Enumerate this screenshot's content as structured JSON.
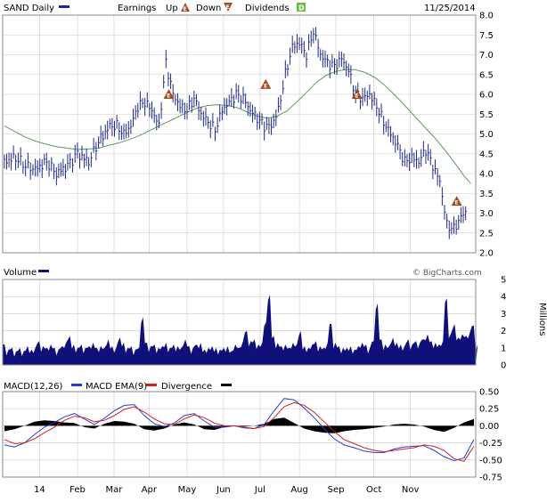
{
  "header": {
    "symbol_label": "SAND Daily",
    "earnings_label": "Earnings",
    "up_label": "Up",
    "down_label": "Down",
    "dividends_label": "Dividends",
    "date": "11/25/2014",
    "earnings_up_icon": "triangle-e-icon",
    "earnings_down_icon": "inverted-triangle-e-icon",
    "dividend_icon": "green-square-d-icon",
    "e_glyph": "E",
    "d_glyph": "D"
  },
  "colors": {
    "price": "#1f2a8a",
    "ma": "#5a9a5a",
    "volume": "#10107a",
    "macd": "#1f3fd0",
    "macd_ema": "#d02020",
    "divergence": "#000000",
    "earnings": "#a34a1f",
    "dividend": "#6bbf3a",
    "grid": "#c8c8c8",
    "frame": "#888888"
  },
  "watermark": "© BigCharts.com",
  "chart_data": [
    {
      "type": "ohlc",
      "name": "price",
      "symbol": "SAND",
      "ylim": [
        2.0,
        8.0
      ],
      "y_ticks": [
        "8.0",
        "7.5",
        "7.0",
        "6.5",
        "6.0",
        "5.5",
        "5.0",
        "4.5",
        "4.0",
        "3.5",
        "3.0",
        "2.5",
        "2.0"
      ],
      "x_ticks": [
        "14",
        "Feb",
        "Mar",
        "Apr",
        "May",
        "Jun",
        "Jul",
        "Aug",
        "Sep",
        "Oct",
        "Nov"
      ],
      "x": [
        0,
        8,
        15,
        22,
        30,
        37,
        45,
        52,
        60,
        67,
        75,
        80,
        85,
        90,
        95,
        100,
        105,
        110,
        115,
        120,
        125,
        130,
        135,
        140,
        145,
        150,
        155,
        160,
        165,
        170,
        175,
        180,
        185,
        190,
        195,
        200,
        205,
        210,
        215,
        220,
        225,
        230,
        235,
        240,
        245,
        250,
        255,
        260,
        265,
        270,
        275,
        280,
        285,
        290,
        295,
        300,
        305,
        310,
        315,
        320,
        325,
        330
      ],
      "close": [
        4.3,
        4.4,
        4.2,
        4.1,
        4.3,
        4.0,
        4.2,
        4.5,
        4.3,
        4.8,
        5.2,
        5.2,
        5.0,
        5.2,
        5.7,
        5.8,
        5.6,
        5.2,
        6.8,
        6.0,
        5.7,
        5.6,
        5.9,
        5.5,
        5.3,
        5.1,
        5.6,
        5.8,
        6.0,
        5.9,
        5.6,
        5.4,
        5.2,
        5.2,
        5.6,
        6.5,
        7.2,
        7.3,
        7.0,
        7.6,
        7.0,
        6.8,
        6.7,
        6.9,
        6.6,
        6.0,
        5.9,
        6.0,
        5.7,
        5.3,
        5.0,
        4.7,
        4.3,
        4.4,
        4.3,
        4.6,
        4.2,
        3.8,
        2.7,
        2.6,
        2.9,
        3.1
      ],
      "ma": [
        5.2,
        5.05,
        4.92,
        4.82,
        4.74,
        4.68,
        4.64,
        4.61,
        4.62,
        4.64,
        4.72,
        4.78,
        4.86,
        4.96,
        5.08,
        5.2,
        5.32,
        5.44,
        5.56,
        5.66,
        5.72,
        5.74,
        5.72,
        5.66,
        5.55,
        5.45,
        5.4,
        5.45,
        5.58,
        5.8,
        6.05,
        6.3,
        6.48,
        6.58,
        6.63,
        6.62,
        6.55,
        6.42,
        6.22,
        5.98,
        5.72,
        5.45,
        5.18,
        4.92,
        4.62,
        4.3,
        3.95,
        3.75
      ],
      "ma_x": [
        0,
        8,
        15,
        22,
        30,
        37,
        45,
        52,
        60,
        67,
        75,
        82,
        89,
        96,
        103,
        110,
        117,
        124,
        131,
        138,
        145,
        152,
        159,
        166,
        173,
        180,
        187,
        194,
        201,
        208,
        215,
        222,
        229,
        236,
        243,
        250,
        257,
        264,
        271,
        278,
        285,
        292,
        299,
        306,
        313,
        320,
        327,
        332
      ],
      "earnings_markers": [
        {
          "x": 117,
          "y": 6.0
        },
        {
          "x": 186,
          "y": 6.25
        },
        {
          "x": 251,
          "y": 6.0
        },
        {
          "x": 322,
          "y": 3.3
        }
      ]
    },
    {
      "type": "area",
      "name": "volume",
      "ylabel": "Millions",
      "ylim": [
        0,
        5
      ],
      "y_ticks": [
        "5",
        "4",
        "3",
        "2",
        "1",
        "0"
      ],
      "values": [
        1.2,
        0.9,
        1.0,
        0.8,
        1.0,
        0.8,
        1.1,
        0.9,
        1.0,
        1.4,
        1.1,
        1.0,
        1.2,
        1.0,
        0.9,
        1.1,
        1.3,
        1.7,
        1.2,
        1.0,
        1.2,
        1.0,
        1.1,
        1.3,
        1.0,
        1.1,
        1.0,
        1.5,
        1.1,
        1.0,
        1.6,
        1.3,
        1.0,
        1.1,
        0.9,
        1.0,
        2.8,
        1.3,
        1.1,
        1.2,
        1.0,
        1.1,
        1.3,
        1.0,
        1.2,
        1.1,
        1.0,
        1.5,
        1.1,
        1.0,
        1.2,
        1.3,
        0.9,
        1.0,
        1.1,
        1.0,
        0.9,
        1.0,
        1.1,
        0.8,
        1.2,
        1.0,
        1.4,
        2.0,
        1.4,
        1.5,
        1.2,
        1.3,
        2.5,
        4.1,
        1.7,
        1.3,
        1.1,
        1.2,
        1.0,
        1.3,
        1.2,
        2.0,
        1.1,
        1.0,
        1.2,
        1.4,
        1.1,
        1.0,
        1.3,
        2.4,
        1.3,
        1.1,
        1.0,
        1.0,
        1.1,
        0.9,
        1.1,
        1.3,
        1.2,
        1.0,
        1.4,
        3.6,
        1.5,
        1.2,
        1.1,
        1.6,
        1.3,
        1.2,
        1.1,
        1.5,
        1.2,
        1.4,
        1.3,
        1.5,
        1.8,
        1.4,
        1.3,
        1.2,
        1.4,
        3.9,
        1.8,
        2.4,
        1.6,
        1.8,
        1.7,
        1.9,
        2.3,
        1.2
      ]
    },
    {
      "type": "line",
      "name": "macd",
      "title": "MACD(12,26)",
      "ylim": [
        -0.75,
        0.5
      ],
      "y_ticks": [
        "0.50",
        "0.25",
        "0.00",
        "-0.25",
        "-0.50",
        "-0.75"
      ],
      "series": [
        {
          "name": "MACD EMA(9)",
          "values": [
            -0.2,
            -0.26,
            -0.25,
            -0.19,
            -0.1,
            -0.02,
            0.08,
            0.14,
            0.12,
            0.06,
            0.08,
            0.15,
            0.24,
            0.28,
            0.2,
            0.1,
            0.03,
            0.02,
            0.1,
            0.16,
            0.12,
            0.04,
            0.0,
            0.0,
            -0.02,
            -0.04,
            -0.01,
            0.12,
            0.28,
            0.34,
            0.3,
            0.2,
            0.06,
            -0.08,
            -0.2,
            -0.26,
            -0.32,
            -0.36,
            -0.38,
            -0.36,
            -0.34,
            -0.32,
            -0.28,
            -0.3,
            -0.36,
            -0.48,
            -0.52,
            -0.3
          ]
        },
        {
          "name": "Divergence",
          "values": [
            -0.08,
            -0.05,
            0.0,
            0.06,
            0.08,
            0.07,
            0.05,
            0.04,
            -0.02,
            -0.04,
            0.03,
            0.07,
            0.06,
            0.03,
            -0.05,
            -0.07,
            -0.04,
            0.02,
            0.05,
            0.02,
            -0.05,
            -0.06,
            -0.02,
            0.0,
            -0.01,
            0.0,
            0.03,
            0.1,
            0.12,
            0.04,
            -0.04,
            -0.08,
            -0.1,
            -0.11,
            -0.08,
            -0.06,
            -0.05,
            -0.03,
            -0.01,
            0.02,
            0.03,
            0.02,
            -0.01,
            -0.06,
            -0.09,
            -0.03,
            0.05,
            0.1
          ]
        }
      ],
      "macd": [
        -0.28,
        -0.31,
        -0.25,
        -0.13,
        -0.02,
        0.05,
        0.13,
        0.18,
        0.1,
        0.02,
        0.11,
        0.22,
        0.3,
        0.31,
        0.15,
        0.03,
        -0.01,
        0.04,
        0.15,
        0.18,
        0.07,
        -0.02,
        -0.02,
        0.0,
        -0.03,
        -0.04,
        0.02,
        0.22,
        0.4,
        0.38,
        0.26,
        0.12,
        -0.04,
        -0.19,
        -0.28,
        -0.32,
        -0.37,
        -0.39,
        -0.39,
        -0.34,
        -0.31,
        -0.3,
        -0.29,
        -0.36,
        -0.45,
        -0.51,
        -0.47,
        -0.2
      ]
    }
  ]
}
